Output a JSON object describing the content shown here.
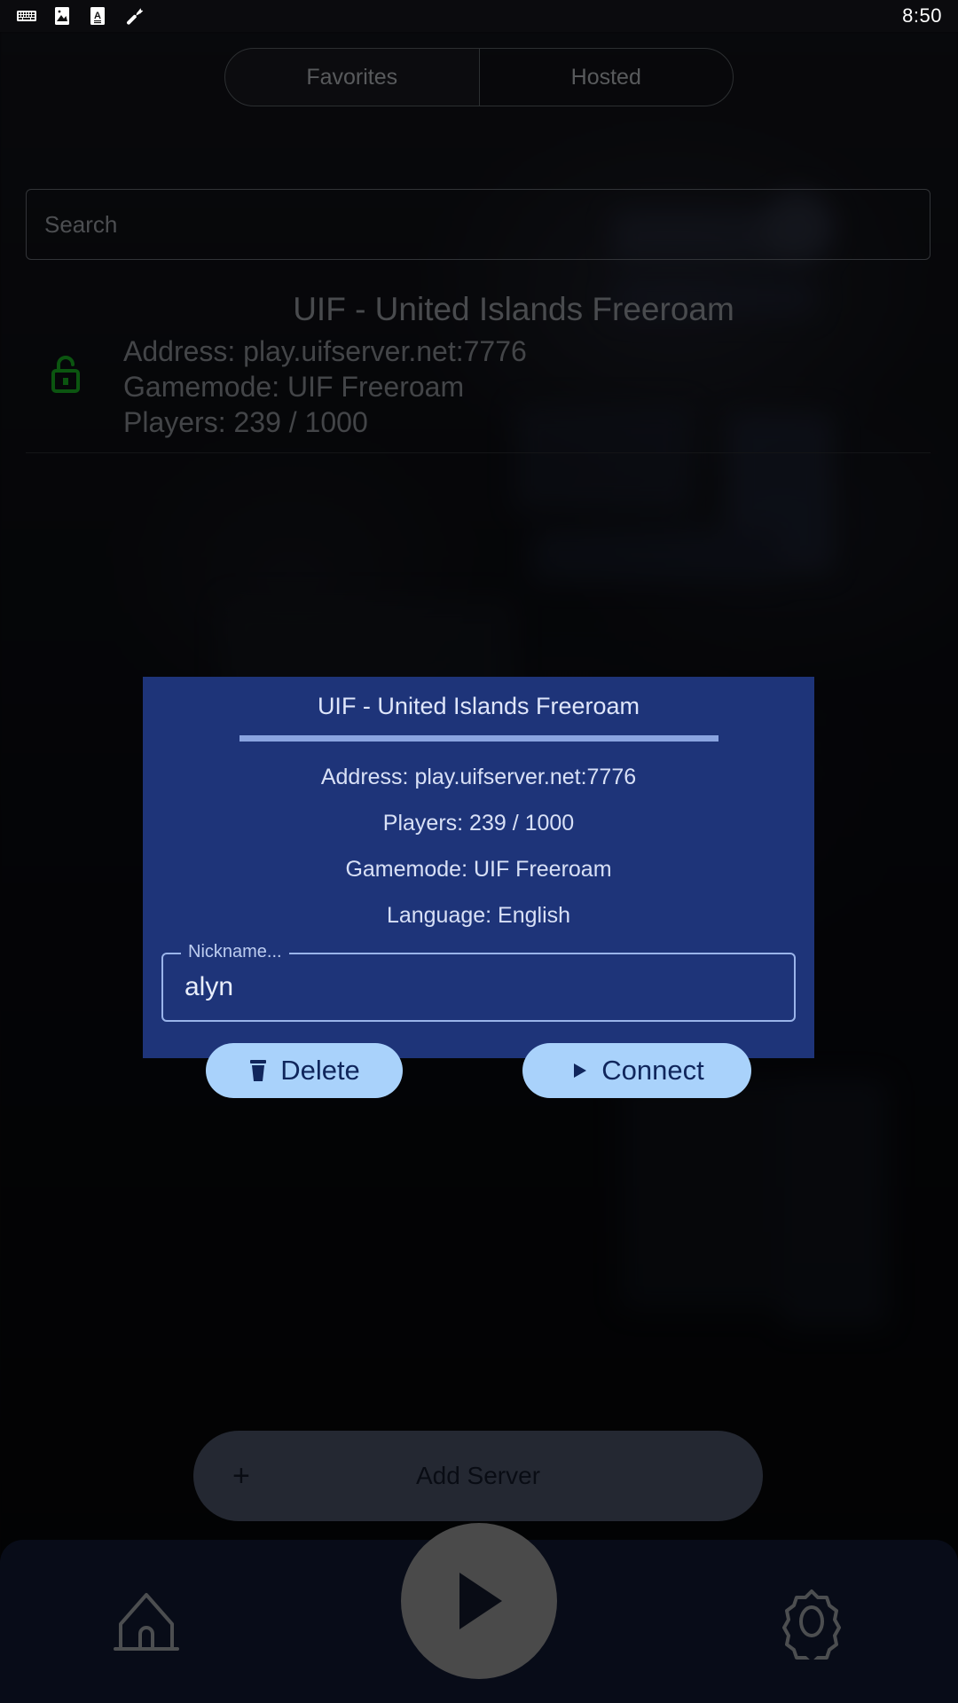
{
  "status_bar": {
    "time": "8:50",
    "icons": [
      "keyboard-icon",
      "image-icon",
      "text-format-icon",
      "wrench-icon"
    ]
  },
  "tabs": {
    "items": [
      {
        "label": "Favorites",
        "active": true
      },
      {
        "label": "Hosted",
        "active": false
      }
    ]
  },
  "search": {
    "placeholder": "Search",
    "value": ""
  },
  "server_list": [
    {
      "lock_icon": "unlocked-padlock-icon",
      "lock_color": "#17b222",
      "name": "UIF - United Islands Freeroam",
      "address": "Address: play.uifserver.net:7776",
      "gamemode": "Gamemode: UIF Freeroam",
      "players": "Players: 239 / 1000"
    }
  ],
  "add_server": {
    "label": "Add Server",
    "icon": "plus-icon"
  },
  "bottom_nav": {
    "items": [
      {
        "icon": "home-icon",
        "name": "home"
      },
      {
        "icon": "play-icon",
        "name": "play"
      },
      {
        "icon": "gear-icon",
        "name": "settings"
      }
    ]
  },
  "dialog": {
    "title": "UIF - United Islands Freeroam",
    "address": "Address: play.uifserver.net:7776",
    "players": "Players: 239 / 1000",
    "gamemode": "Gamemode: UIF Freeroam",
    "language": "Language: English",
    "nickname": {
      "label": "Nickname...",
      "value": "alyn"
    },
    "delete_label": "Delete",
    "connect_label": "Connect",
    "delete_icon": "trash-icon",
    "connect_icon": "play-triangle-icon"
  },
  "colors": {
    "dialog_bg": "#1e3479",
    "dialog_button": "#a9d2fb",
    "dialog_button_text": "#10265c",
    "divider": "#8aa4e0",
    "lock_green": "#17b222",
    "nav_bg": "#111a33",
    "add_server_bg": "#4c5569",
    "screen_bg": "#0a0a0d"
  }
}
